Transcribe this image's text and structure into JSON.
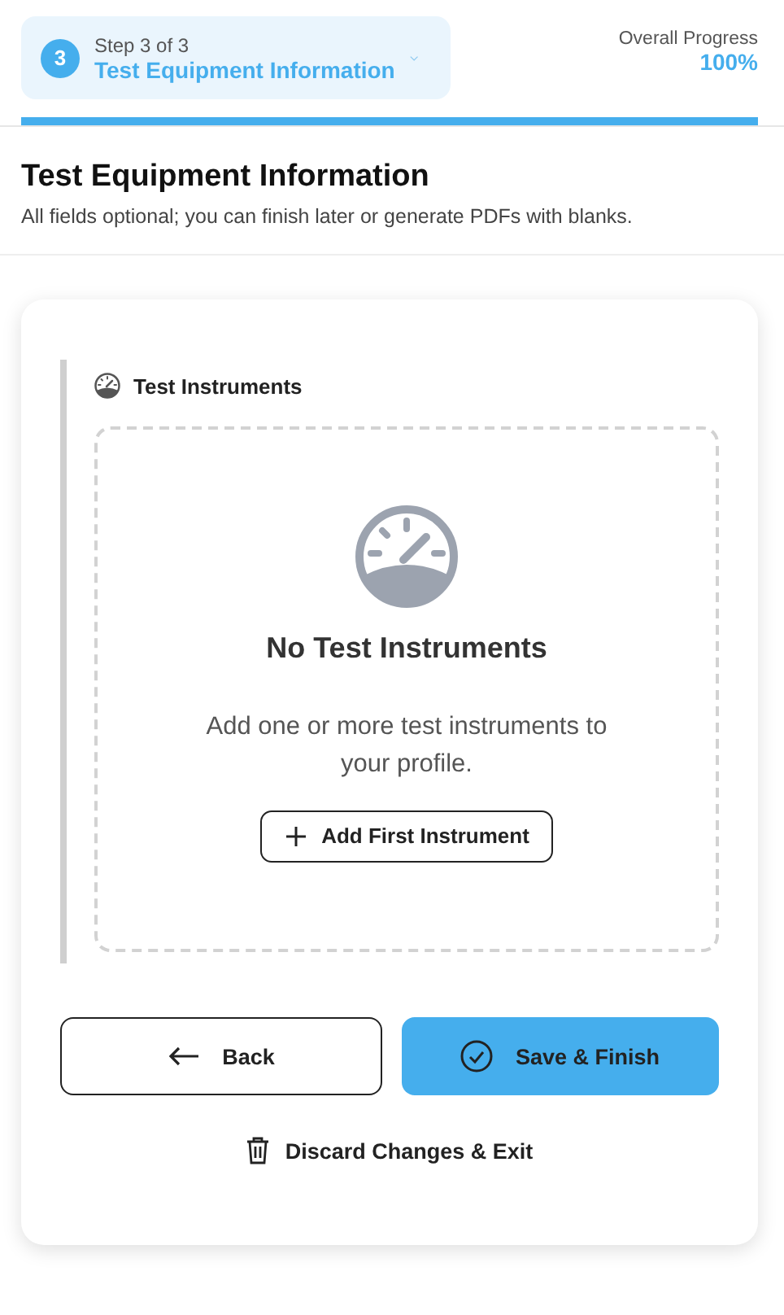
{
  "header": {
    "step_number": "3",
    "step_label": "Step 3 of 3",
    "step_title": "Test Equipment Information",
    "progress_label": "Overall Progress",
    "progress_value": "100%",
    "level": 1
  },
  "intro": {
    "title": "Test Equipment Information",
    "subtitle": "All fields optional; you can finish later or generate PDFs with blanks."
  },
  "section": {
    "title": "Test Instruments",
    "empty_title": "No Test Instruments",
    "empty_text": "Add one or more test instruments to your profile.",
    "add_button": "Add First Instrument"
  },
  "actions": {
    "back": "Back",
    "save": "Save & Finish",
    "discard": "Discard Changes & Exit"
  }
}
